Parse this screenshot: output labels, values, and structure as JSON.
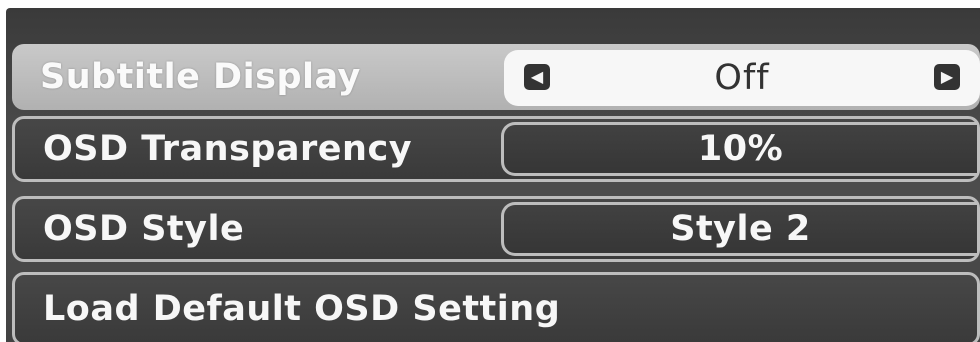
{
  "menu": {
    "items": [
      {
        "label": "Subtitle Display",
        "value": "Off",
        "selected": true
      },
      {
        "label": "OSD Transparency",
        "value": "10%"
      },
      {
        "label": "OSD Style",
        "value": "Style 2"
      },
      {
        "label": "Load Default OSD Setting"
      }
    ]
  },
  "icons": {
    "left_arrow": "left-arrow-icon",
    "right_arrow": "right-arrow-icon"
  },
  "colors": {
    "background": "#434343",
    "selected_row": "#bdbdbd",
    "selected_value_box": "#f7f7f7",
    "text": "#f7f7f7",
    "row_border": "#bdbdbd"
  }
}
